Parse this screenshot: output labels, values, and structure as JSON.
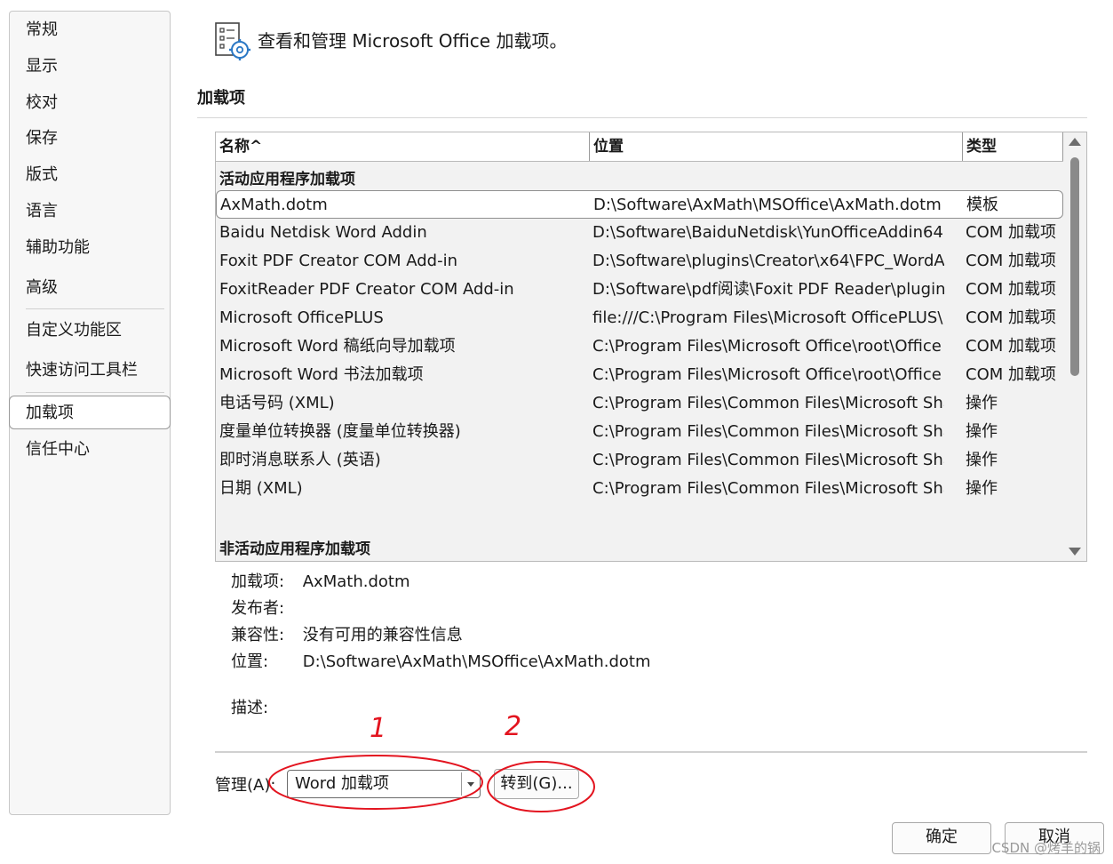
{
  "sidebar": {
    "items": [
      {
        "label": "常规"
      },
      {
        "label": "显示"
      },
      {
        "label": "校对"
      },
      {
        "label": "保存"
      },
      {
        "label": "版式"
      },
      {
        "label": "语言"
      },
      {
        "label": "辅助功能"
      },
      {
        "label": "高级"
      },
      {
        "label": "自定义功能区"
      },
      {
        "label": "快速访问工具栏"
      },
      {
        "label": "加载项",
        "active": true
      },
      {
        "label": "信任中心"
      }
    ]
  },
  "header": {
    "icon": "addins-settings-icon",
    "text": "查看和管理 Microsoft Office 加载项。"
  },
  "section": {
    "title": "加载项"
  },
  "table": {
    "columns": [
      "名称^",
      "位置",
      "类型"
    ],
    "groups": [
      {
        "label": "活动应用程序加载项",
        "rows": [
          {
            "name": "AxMath.dotm",
            "location": "D:\\Software\\AxMath\\MSOffice\\AxMath.dotm",
            "type": "模板",
            "selected": true
          },
          {
            "name": "Baidu Netdisk Word Addin",
            "location": "D:\\Software\\BaiduNetdisk\\YunOfficeAddin64.",
            "type": "COM 加载项"
          },
          {
            "name": "Foxit PDF Creator COM Add-in",
            "location": "D:\\Software\\plugins\\Creator\\x64\\FPC_WordA",
            "type": "COM 加载项"
          },
          {
            "name": "FoxitReader PDF Creator COM Add-in",
            "location": "D:\\Software\\pdf阅读\\Foxit PDF Reader\\plugin",
            "type": "COM 加载项"
          },
          {
            "name": "Microsoft OfficePLUS",
            "location": "file:///C:\\Program Files\\Microsoft OfficePLUS\\",
            "type": "COM 加载项"
          },
          {
            "name": "Microsoft Word 稿纸向导加载项",
            "location": "C:\\Program Files\\Microsoft Office\\root\\Office",
            "type": "COM 加载项"
          },
          {
            "name": "Microsoft Word 书法加载项",
            "location": "C:\\Program Files\\Microsoft Office\\root\\Office",
            "type": "COM 加载项"
          },
          {
            "name": "电话号码 (XML)",
            "location": "C:\\Program Files\\Common Files\\Microsoft Sha",
            "type": "操作"
          },
          {
            "name": "度量单位转换器 (度量单位转换器)",
            "location": "C:\\Program Files\\Common Files\\Microsoft Sha",
            "type": "操作"
          },
          {
            "name": "即时消息联系人 (英语)",
            "location": "C:\\Program Files\\Common Files\\Microsoft Sha",
            "type": "操作"
          },
          {
            "name": "日期 (XML)",
            "location": "C:\\Program Files\\Common Files\\Microsoft Sha",
            "type": "操作"
          }
        ]
      },
      {
        "label": "非活动应用程序加载项",
        "rows": []
      }
    ]
  },
  "details": {
    "addin_label": "加载项:",
    "addin_value": "AxMath.dotm",
    "publisher_label": "发布者:",
    "publisher_value": "",
    "compat_label": "兼容性:",
    "compat_value": "没有可用的兼容性信息",
    "location_label": "位置:",
    "location_value": "D:\\Software\\AxMath\\MSOffice\\AxMath.dotm",
    "desc_label": "描述:"
  },
  "manage": {
    "label": "管理(A):",
    "selected": "Word 加载项",
    "go_button": "转到(G)..."
  },
  "footer": {
    "ok": "确定",
    "cancel": "取消"
  },
  "annotations": {
    "one": "1",
    "two": "2",
    "color": "#e3141f"
  },
  "watermark": "CSDN @烤羊的锅"
}
